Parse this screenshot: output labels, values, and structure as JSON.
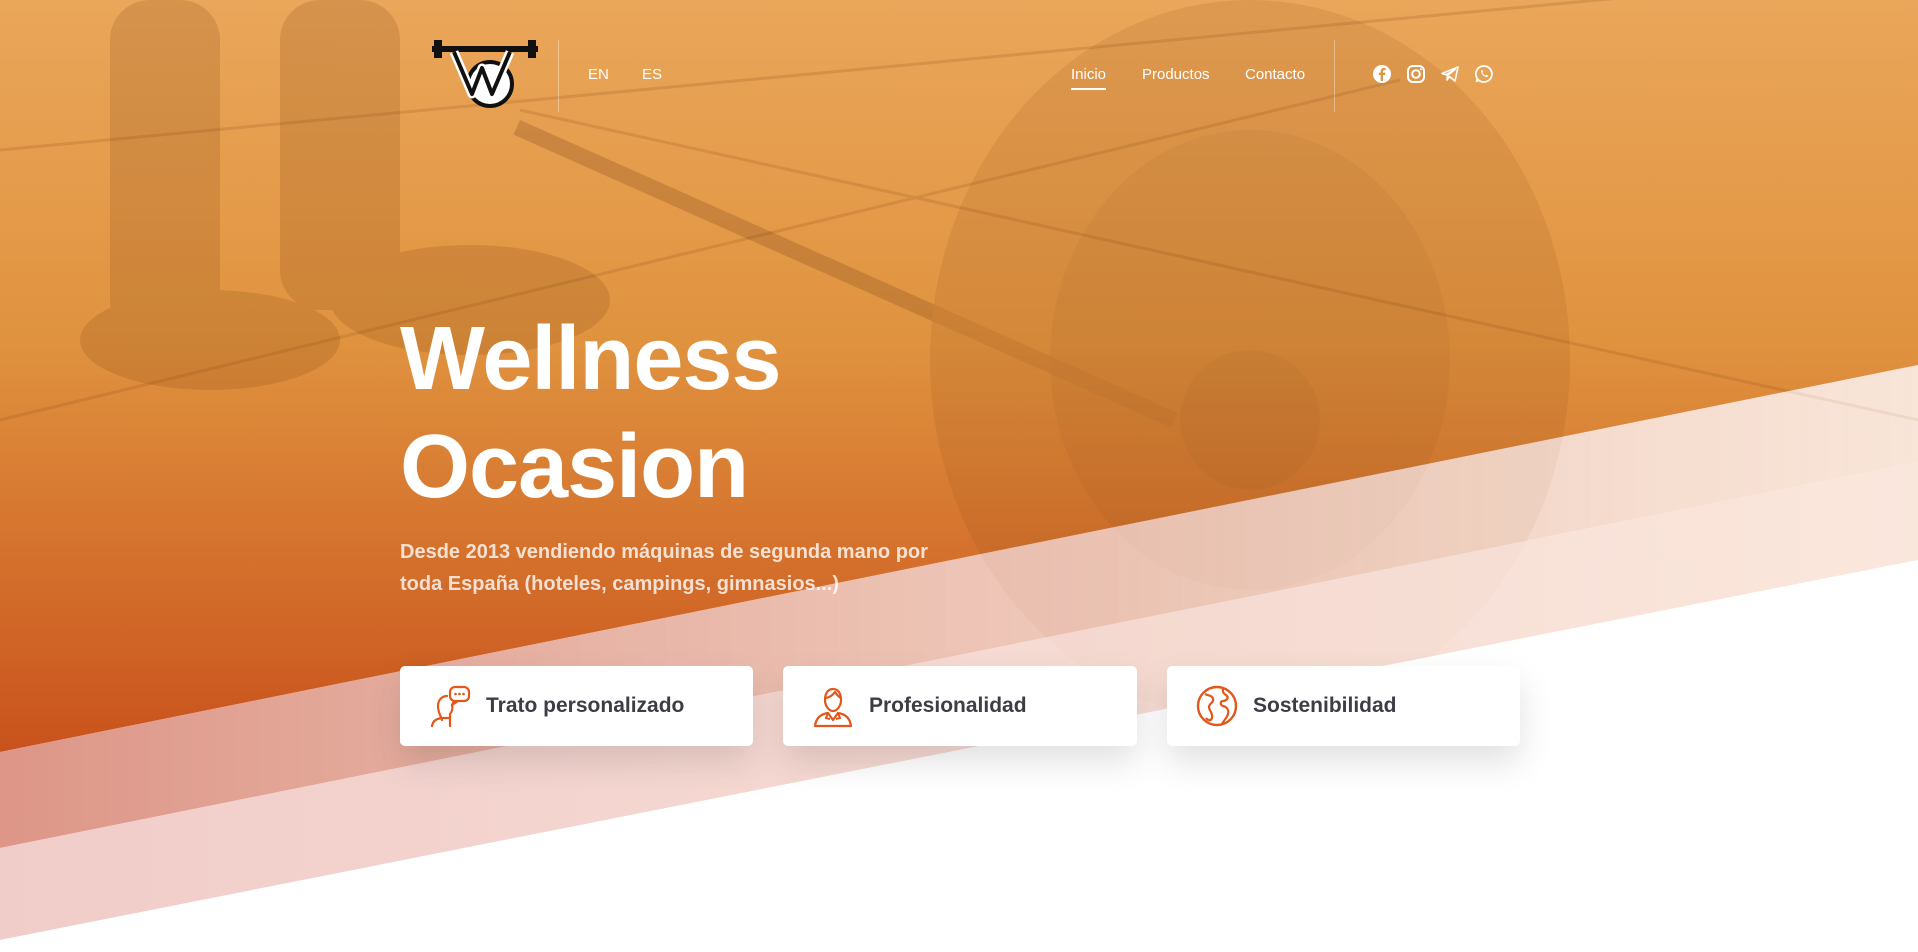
{
  "header": {
    "logo_letters": "WO",
    "languages": [
      {
        "label": "EN"
      },
      {
        "label": "ES"
      }
    ],
    "nav": [
      {
        "label": "Inicio",
        "active": true
      },
      {
        "label": "Productos",
        "active": false
      },
      {
        "label": "Contacto",
        "active": false
      }
    ],
    "social": [
      "facebook-icon",
      "instagram-icon",
      "telegram-icon",
      "whatsapp-icon"
    ]
  },
  "hero": {
    "title_line1": "Wellness",
    "title_line2": "Ocasion",
    "subtitle": "Desde 2013 vendiendo máquinas de segunda mano por toda España (hoteles, campings, gimnasios...)"
  },
  "features": [
    {
      "label": "Trato personalizado",
      "icon": "speech-person-icon"
    },
    {
      "label": "Profesionalidad",
      "icon": "professional-person-icon"
    },
    {
      "label": "Sostenibilidad",
      "icon": "globe-icon"
    }
  ],
  "colors": {
    "orange_top": "#e9a85e",
    "orange_bottom": "#c9521c",
    "accent_icon": "#e2571b",
    "feature_text": "#3d3d47",
    "white": "#ffffff"
  }
}
